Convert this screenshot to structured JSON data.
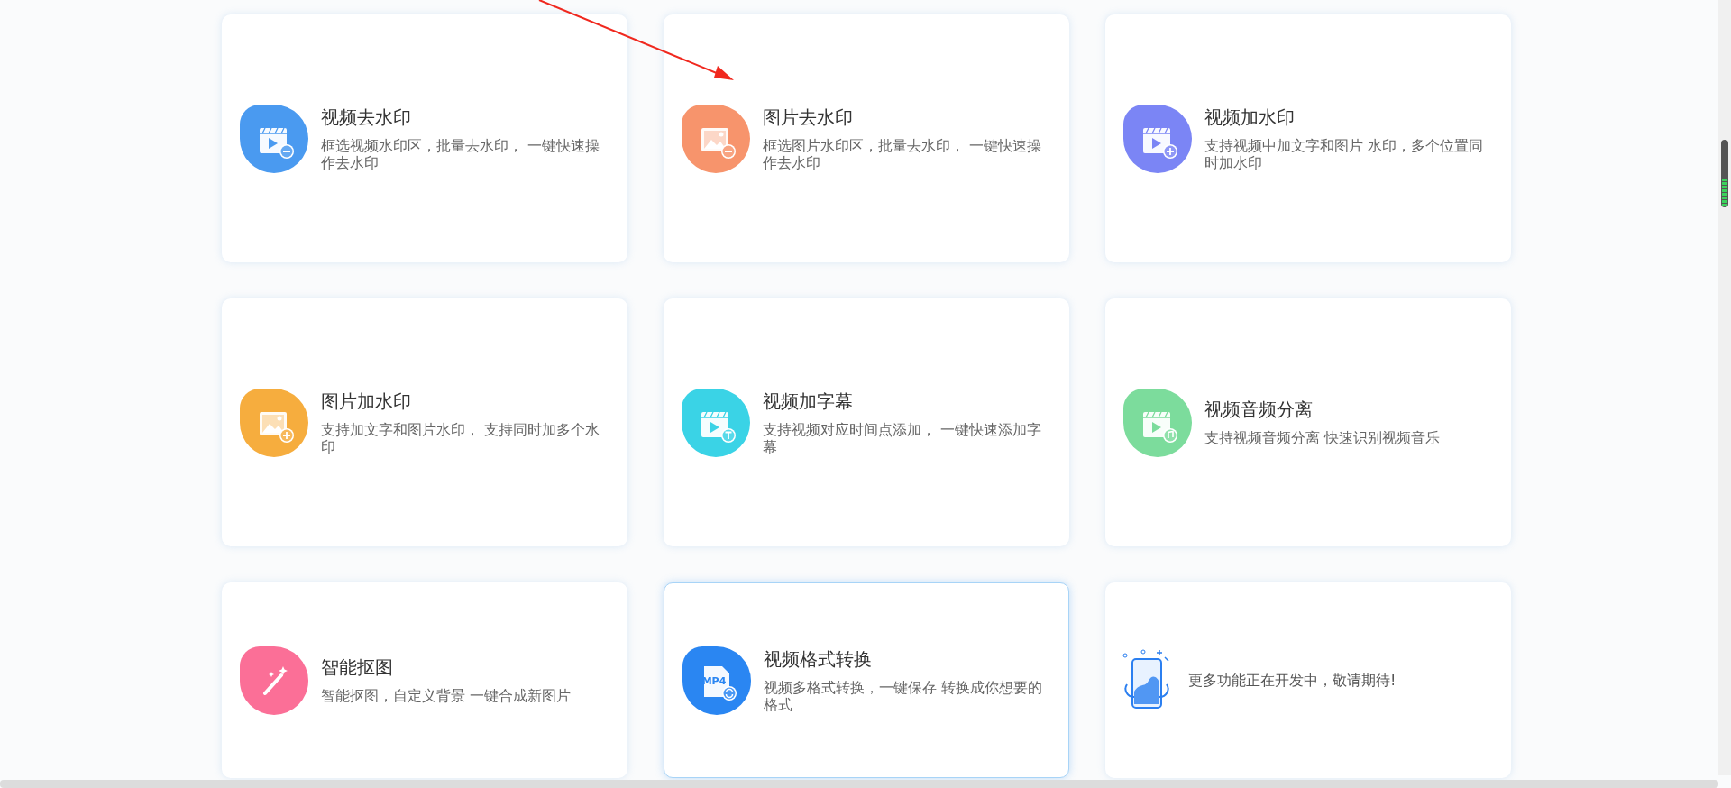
{
  "cards": [
    {
      "kind": "feature",
      "title": "视频去水印",
      "description": "框选视频水印区，批量去水印， 一键快速操作去水印",
      "color": "#4a9af0",
      "selected": false
    },
    {
      "kind": "feature",
      "title": "图片去水印",
      "description": "框选图片水印区，批量去水印， 一键快速操作去水印",
      "color": "#f7946c",
      "selected": false
    },
    {
      "kind": "feature",
      "title": "视频加水印",
      "description": "支持视频中加文字和图片 水印，多个位置同时加水印",
      "color": "#7b85f5",
      "selected": false
    },
    {
      "kind": "feature",
      "title": "图片加水印",
      "description": "支持加文字和图片水印， 支持同时加多个水印",
      "color": "#f6ad3e",
      "selected": false
    },
    {
      "kind": "feature",
      "title": "视频加字幕",
      "description": "支持视频对应时间点添加， 一键快速添加字幕",
      "color": "#3ad3e6",
      "selected": false
    },
    {
      "kind": "feature",
      "title": "视频音频分离",
      "description": "支持视频音频分离 快速识别视频音乐",
      "color": "#7cdc9c",
      "selected": false
    },
    {
      "kind": "feature",
      "title": "智能抠图",
      "description": "智能抠图，自定义背景 一键合成新图片",
      "color": "#fb6f97",
      "selected": false
    },
    {
      "kind": "feature",
      "title": "视频格式转换",
      "description": "视频多格式转换，一键保存 转换成你想要的格式",
      "icon_label": "MP4",
      "color": "#2a86f2",
      "selected": true
    },
    {
      "kind": "coming_soon",
      "description": "更多功能正在开发中，敬请期待!"
    }
  ]
}
